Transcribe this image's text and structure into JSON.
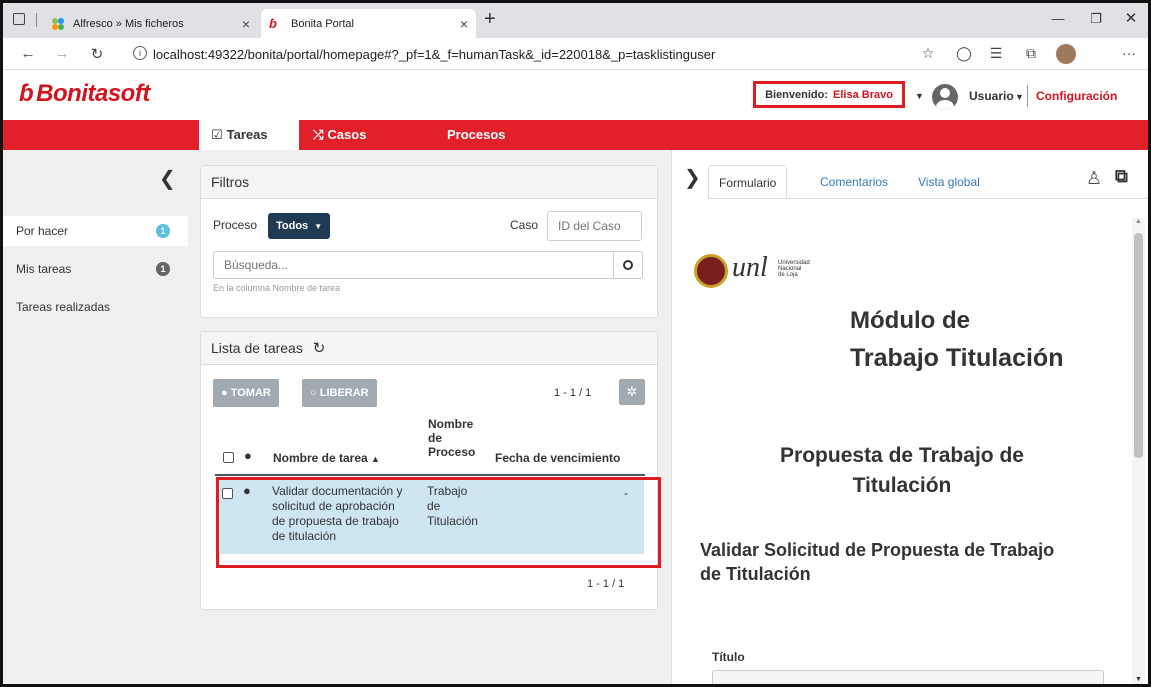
{
  "browser": {
    "tabs": [
      {
        "title": "Alfresco » Mis ficheros",
        "close": "×"
      },
      {
        "title": "Bonita Portal",
        "close": "×"
      }
    ],
    "new_tab": "+",
    "url": "localhost:49322/bonita/portal/homepage#?_pf=1&_f=humanTask&_id=220018&_p=tasklistinguser"
  },
  "header": {
    "logo": "Bonitasoft",
    "welcome_label": "Bienvenido:",
    "user_name": "Elisa Bravo",
    "user_menu": "Usuario",
    "settings": "Configuración"
  },
  "nav": {
    "tabs": [
      "Tareas",
      "Casos",
      "Procesos"
    ]
  },
  "sidebar": {
    "items": [
      {
        "label": "Por hacer",
        "badge": "1",
        "badge_color": "#5bc0de"
      },
      {
        "label": "Mis tareas",
        "badge": "1",
        "badge_color": "#666666"
      },
      {
        "label": "Tareas realizadas"
      }
    ]
  },
  "filters": {
    "title": "Filtros",
    "process_label": "Proceso",
    "process_value": "Todos",
    "case_label": "Caso",
    "case_placeholder": "ID del Caso",
    "search_placeholder": "Búsqueda...",
    "search_hint": "En la columna Nombre de tarea"
  },
  "tasklist": {
    "title": "Lista de tareas",
    "take_label": "TOMAR",
    "release_label": "LIBERAR",
    "pagination_top": "1 - 1 / 1",
    "pagination_bottom": "1 - 1 / 1",
    "columns": {
      "name": "Nombre de tarea",
      "process_1": "Nombre",
      "process_2": "de",
      "process_3": "Proceso",
      "due": "Fecha de vencimiento"
    },
    "rows": [
      {
        "name_lines": [
          "Validar documentación y",
          "solicitud de aprobación",
          "de propuesta de trabajo",
          "de titulación"
        ],
        "process_lines": [
          "Trabajo",
          "de",
          "Titulación"
        ],
        "due": "-"
      }
    ]
  },
  "form": {
    "tabs": [
      "Formulario",
      "Comentarios",
      "Vista global"
    ],
    "logo_text": "unl",
    "logo_sub": [
      "Universidad",
      "Nacional",
      "de Loja"
    ],
    "heading_1": "Módulo de",
    "heading_2": "Trabajo Titulación",
    "subheading_1": "Propuesta de Trabajo de",
    "subheading_2": "Titulación",
    "section_1": "Validar Solicitud de Propuesta de Trabajo",
    "section_2": "de Titulación",
    "field_label": "Título"
  },
  "colors": {
    "brand_red": "#e2202a",
    "highlight_border": "#e01b22",
    "selected_row": "#cde6f2",
    "dark_button": "#1f3a52"
  }
}
